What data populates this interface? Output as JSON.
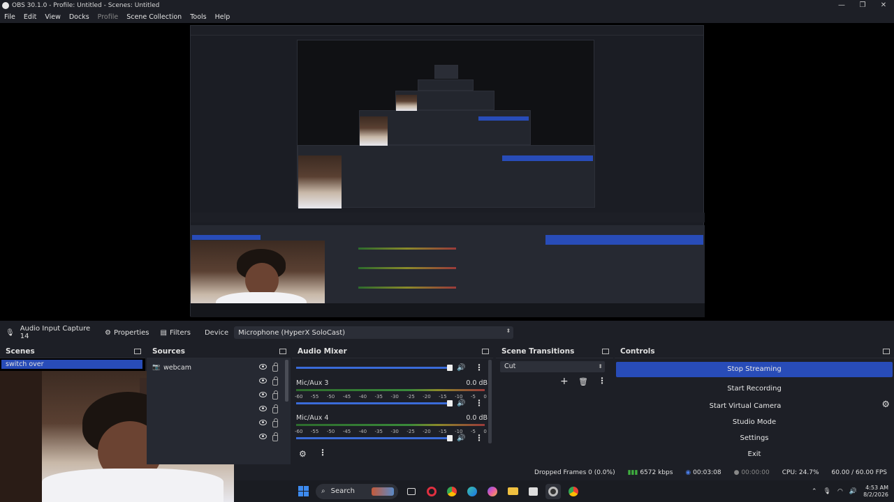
{
  "window": {
    "title": "OBS 30.1.0 - Profile: Untitled - Scenes: Untitled",
    "controls": [
      "—",
      "❐",
      "✕"
    ]
  },
  "menu": {
    "items": [
      {
        "label": "File",
        "disabled": false
      },
      {
        "label": "Edit",
        "disabled": false
      },
      {
        "label": "View",
        "disabled": false
      },
      {
        "label": "Docks",
        "disabled": false
      },
      {
        "label": "Profile",
        "disabled": true
      },
      {
        "label": "Scene Collection",
        "disabled": false
      },
      {
        "label": "Tools",
        "disabled": false
      },
      {
        "label": "Help",
        "disabled": false
      }
    ]
  },
  "source_bar": {
    "source_name": "Audio Input Capture 14",
    "properties_label": "Properties",
    "filters_label": "Filters",
    "device_label": "Device",
    "device_value": "Microphone (HyperX SoloCast)"
  },
  "scenes": {
    "title": "Scenes",
    "items": [
      "switch over"
    ]
  },
  "sources": {
    "title": "Sources",
    "items": [
      "webcam"
    ]
  },
  "mixer": {
    "title": "Audio Mixer",
    "scale": [
      "-60",
      "-55",
      "-50",
      "-45",
      "-40",
      "-35",
      "-30",
      "-25",
      "-20",
      "-15",
      "-10",
      "-5",
      "0"
    ],
    "channels": [
      {
        "name": "Mic/Aux 3",
        "db": "0.0 dB"
      },
      {
        "name": "Mic/Aux 4",
        "db": "0.0 dB"
      }
    ]
  },
  "transitions": {
    "title": "Scene Transitions",
    "selected": "Cut"
  },
  "controls": {
    "title": "Controls",
    "stop_streaming": "Stop Streaming",
    "start_recording": "Start Recording",
    "start_virtual_camera": "Start Virtual Camera",
    "studio_mode": "Studio Mode",
    "settings": "Settings",
    "exit": "Exit"
  },
  "status": {
    "dropped_frames": "Dropped Frames 0 (0.0%)",
    "bitrate": "6572 kbps",
    "stream_time": "00:03:08",
    "rec_time": "00:00:00",
    "cpu": "CPU: 24.7%",
    "fps": "60.00 / 60.00 FPS"
  },
  "taskbar": {
    "search_placeholder": "Search",
    "time": "4:53 AM",
    "date": "8/2/2026"
  },
  "colors": {
    "accent": "#284cb8",
    "background": "#1d1f26",
    "panel": "#262932"
  }
}
